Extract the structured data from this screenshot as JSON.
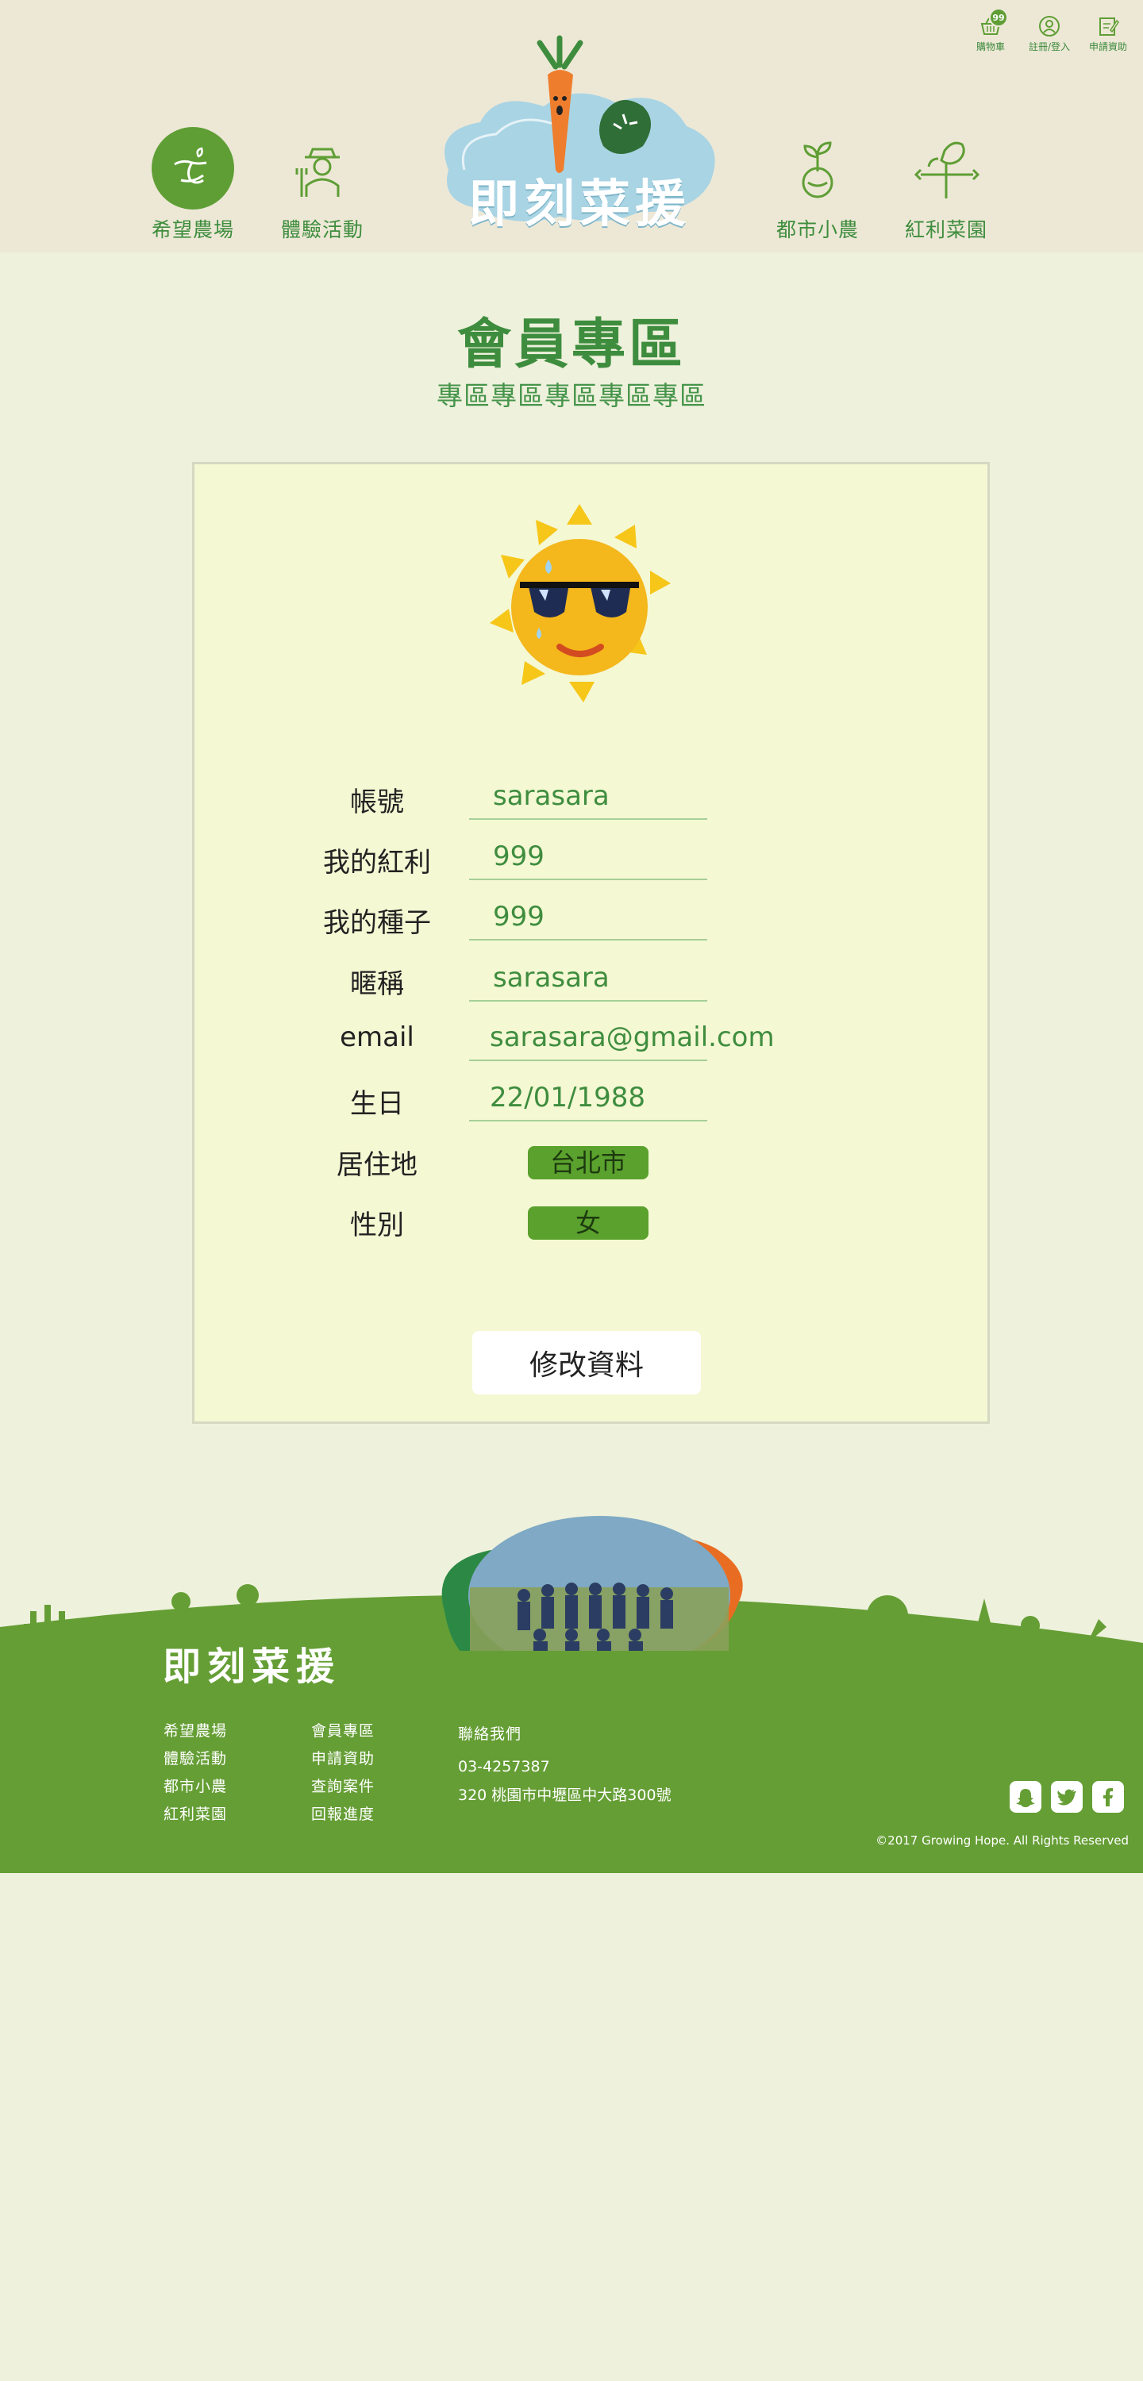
{
  "header": {
    "top_links": [
      {
        "label": "購物車",
        "badge": "99"
      },
      {
        "label": "註冊/登入"
      },
      {
        "label": "申請資助"
      }
    ],
    "nav": [
      {
        "label": "希望農場"
      },
      {
        "label": "體驗活動"
      },
      {
        "label": "都市小農"
      },
      {
        "label": "紅利菜園"
      }
    ],
    "logo_text": "即刻菜援"
  },
  "page": {
    "title": "會員專區",
    "subtitle": "專區專區專區專區專區"
  },
  "profile": {
    "fields": [
      {
        "label": "帳號",
        "value": "sarasara"
      },
      {
        "label": "我的紅利",
        "value": "999"
      },
      {
        "label": "我的種子",
        "value": "999"
      },
      {
        "label": "暱稱",
        "value": "sarasara"
      },
      {
        "label": "email",
        "value": "sarasara@gmail.com"
      },
      {
        "label": "生日",
        "value": "22/01/1988"
      },
      {
        "label": "居住地",
        "value": "台北市"
      },
      {
        "label": "性別",
        "value": "女"
      }
    ],
    "edit_button": "修改資料"
  },
  "footer": {
    "logo_text": "即刻菜援",
    "col1": [
      "希望農場",
      "體驗活動",
      "都市小農",
      "紅利菜園"
    ],
    "col2": [
      "會員專區",
      "申請資助",
      "查詢案件",
      "回報進度"
    ],
    "contact_title": "聯絡我們",
    "phone": "03-4257387",
    "address": "320  桃園市中壢區中大路300號",
    "copyright": "©2017 Growing Hope.  All Rights Reserved",
    "socials": [
      "snapchat-icon",
      "twitter-icon",
      "facebook-icon"
    ]
  },
  "colors": {
    "brand_green": "#3e8d3e",
    "accent_green": "#5f9e35",
    "header_bg": "#ede8d6",
    "page_bg": "#eef1dc",
    "card_bg": "#f4f8d3",
    "footer_bg": "#659e35"
  }
}
